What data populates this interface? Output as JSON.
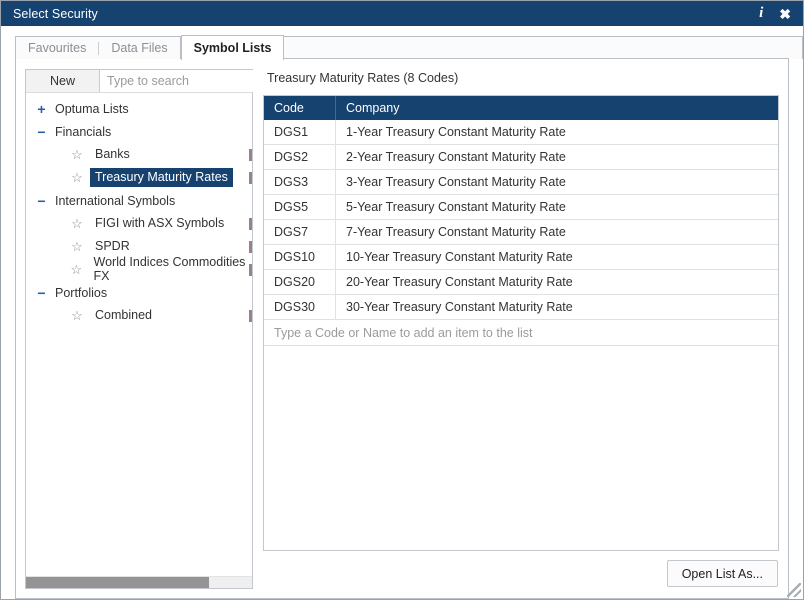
{
  "window": {
    "title": "Select Security",
    "info_icon": "info-icon",
    "close_icon": "close-icon",
    "resize_grip": "resize-grip"
  },
  "tabs": [
    {
      "label": "Favourites",
      "active": false
    },
    {
      "label": "Data Files",
      "active": false
    },
    {
      "label": "Symbol Lists",
      "active": true
    }
  ],
  "sidebar": {
    "new_button": "New",
    "search_placeholder": "Type to search",
    "search_value": "",
    "scrollbar": "horizontal-scrollbar",
    "tree": [
      {
        "type": "group",
        "label": "Optuma Lists",
        "toggle": "+",
        "expanded": false
      },
      {
        "type": "group",
        "label": "Financials",
        "toggle": "−",
        "expanded": true
      },
      {
        "type": "leaf",
        "label": "Banks",
        "icon": "star-icon",
        "selected": false
      },
      {
        "type": "leaf",
        "label": "Treasury Maturity Rates",
        "icon": "star-icon",
        "selected": true
      },
      {
        "type": "group",
        "label": "International Symbols",
        "toggle": "−",
        "expanded": true
      },
      {
        "type": "leaf",
        "label": "FIGI with ASX Symbols",
        "icon": "star-icon",
        "selected": false
      },
      {
        "type": "leaf",
        "label": "SPDR",
        "icon": "star-icon",
        "selected": false
      },
      {
        "type": "leaf",
        "label": "World Indices Commodities FX",
        "icon": "star-icon",
        "selected": false
      },
      {
        "type": "group",
        "label": "Portfolios",
        "toggle": "−",
        "expanded": true
      },
      {
        "type": "leaf",
        "label": "Combined",
        "icon": "star-icon",
        "selected": false
      }
    ]
  },
  "main": {
    "list_title": "Treasury Maturity Rates (8 Codes)",
    "columns": [
      "Code",
      "Company"
    ],
    "rows": [
      {
        "code": "DGS1",
        "company": "1-Year Treasury Constant Maturity Rate"
      },
      {
        "code": "DGS2",
        "company": "2-Year Treasury Constant Maturity Rate"
      },
      {
        "code": "DGS3",
        "company": "3-Year Treasury Constant Maturity Rate"
      },
      {
        "code": "DGS5",
        "company": "5-Year Treasury Constant Maturity Rate"
      },
      {
        "code": "DGS7",
        "company": "7-Year Treasury Constant Maturity Rate"
      },
      {
        "code": "DGS10",
        "company": "10-Year Treasury Constant Maturity Rate"
      },
      {
        "code": "DGS20",
        "company": "20-Year Treasury Constant Maturity Rate"
      },
      {
        "code": "DGS30",
        "company": "30-Year Treasury Constant Maturity Rate"
      }
    ],
    "add_row_placeholder": "Type a Code or Name to add an item to the list"
  },
  "footer": {
    "open_list_as": "Open List As..."
  },
  "colors": {
    "navy": "#164270",
    "toggle_blue": "#1f5fa8",
    "border": "#c3c8ce",
    "placeholder": "#9b9b9b"
  }
}
